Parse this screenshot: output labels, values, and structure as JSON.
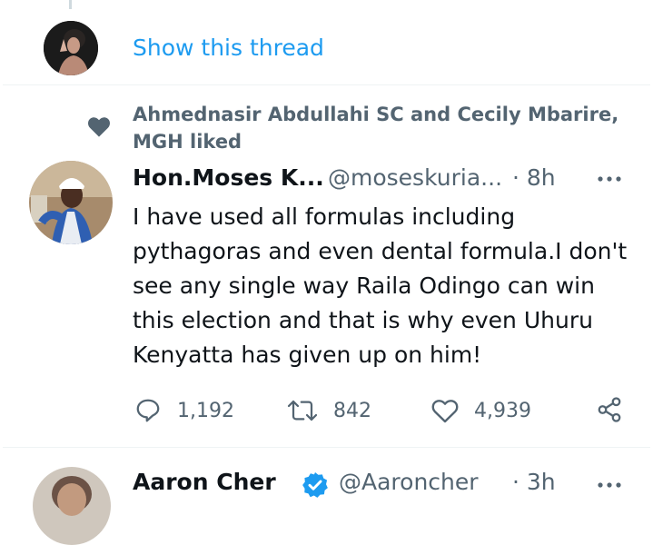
{
  "thread": {
    "show_label": "Show this thread"
  },
  "tweet": {
    "social_context": "Ahmednasir Abdullahi SC and Cecily Mbarire, MGH liked",
    "author_name": "Hon.Moses K...",
    "author_handle": "@moseskuria...",
    "time": "· 8h",
    "text": "I have used all formulas including pythagoras and even dental formula.I don't see any single way Raila Odingo can win this election and that is why even Uhuru Kenyatta has given up on him!",
    "replies": "1,192",
    "retweets": "842",
    "likes": "4,939"
  },
  "next_tweet": {
    "author_name": "Aaron Cher",
    "author_handle": "@Aaroncher",
    "time": "· 3h"
  },
  "colors": {
    "accent": "#1d9bf0",
    "muted": "#536471",
    "text": "#0f1419"
  },
  "icons": [
    "heart-icon",
    "more-icon",
    "reply-icon",
    "retweet-icon",
    "like-icon",
    "share-icon",
    "verified-icon"
  ]
}
